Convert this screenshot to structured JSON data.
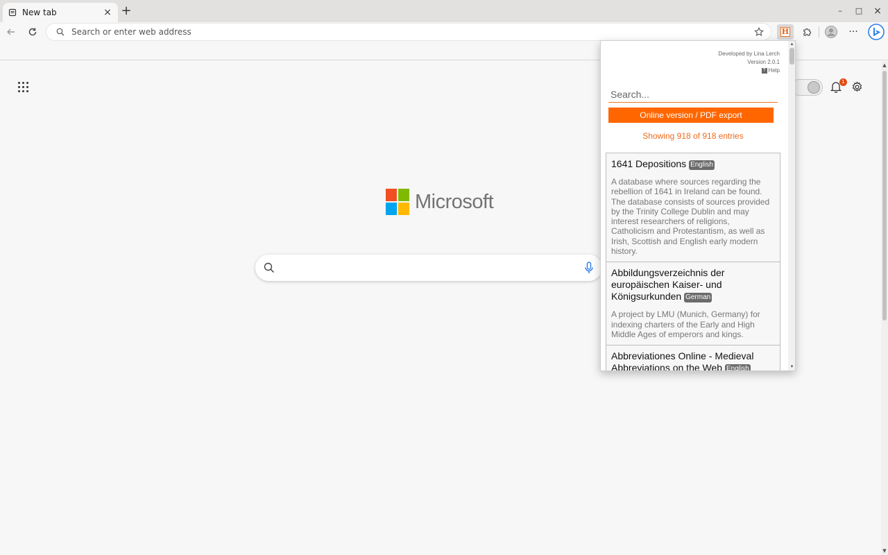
{
  "browser": {
    "tab": {
      "title": "New tab",
      "close": "×"
    },
    "new_tab": "+",
    "window": {
      "minimize": "–",
      "maximize": "□",
      "close": "×"
    },
    "omnibox": {
      "placeholder": "Search or enter web address"
    }
  },
  "page": {
    "logo_text": "Microsoft",
    "notification_count": "1",
    "colors": {
      "ms_red": "#f25022",
      "ms_green": "#7fba00",
      "ms_blue": "#00a4ef",
      "ms_yellow": "#ffb900"
    }
  },
  "popup": {
    "meta": {
      "developer": "Developed by Lina Lerch",
      "version": "Version 2.0.1",
      "help": "Help",
      "help_icon": "?"
    },
    "search_placeholder": "Search...",
    "button_label": "Online version / PDF export",
    "count_text": "Showing 918 of 918 entries",
    "accent_color": "#ff6600",
    "entries": [
      {
        "title": "1641 Depositions",
        "language": "English",
        "description": "A database where sources regarding the rebellion of 1641 in Ireland can be found. The database consists of sources provided by the Trinity College Dublin and may interest researchers of religions, Catholicism and Protestantism, as well as Irish, Scottish and English early modern history."
      },
      {
        "title": "Abbildungsverzeichnis der europäischen Kaiser- und Königsurkunden",
        "language": "German",
        "description": "A project by LMU (Munich, Germany) for indexing charters of the Early and High Middle Ages of emperors and kings."
      },
      {
        "title": "Abbreviationes Online - Medieval Abbreviations on the Web",
        "language": "English",
        "description": ""
      }
    ]
  }
}
